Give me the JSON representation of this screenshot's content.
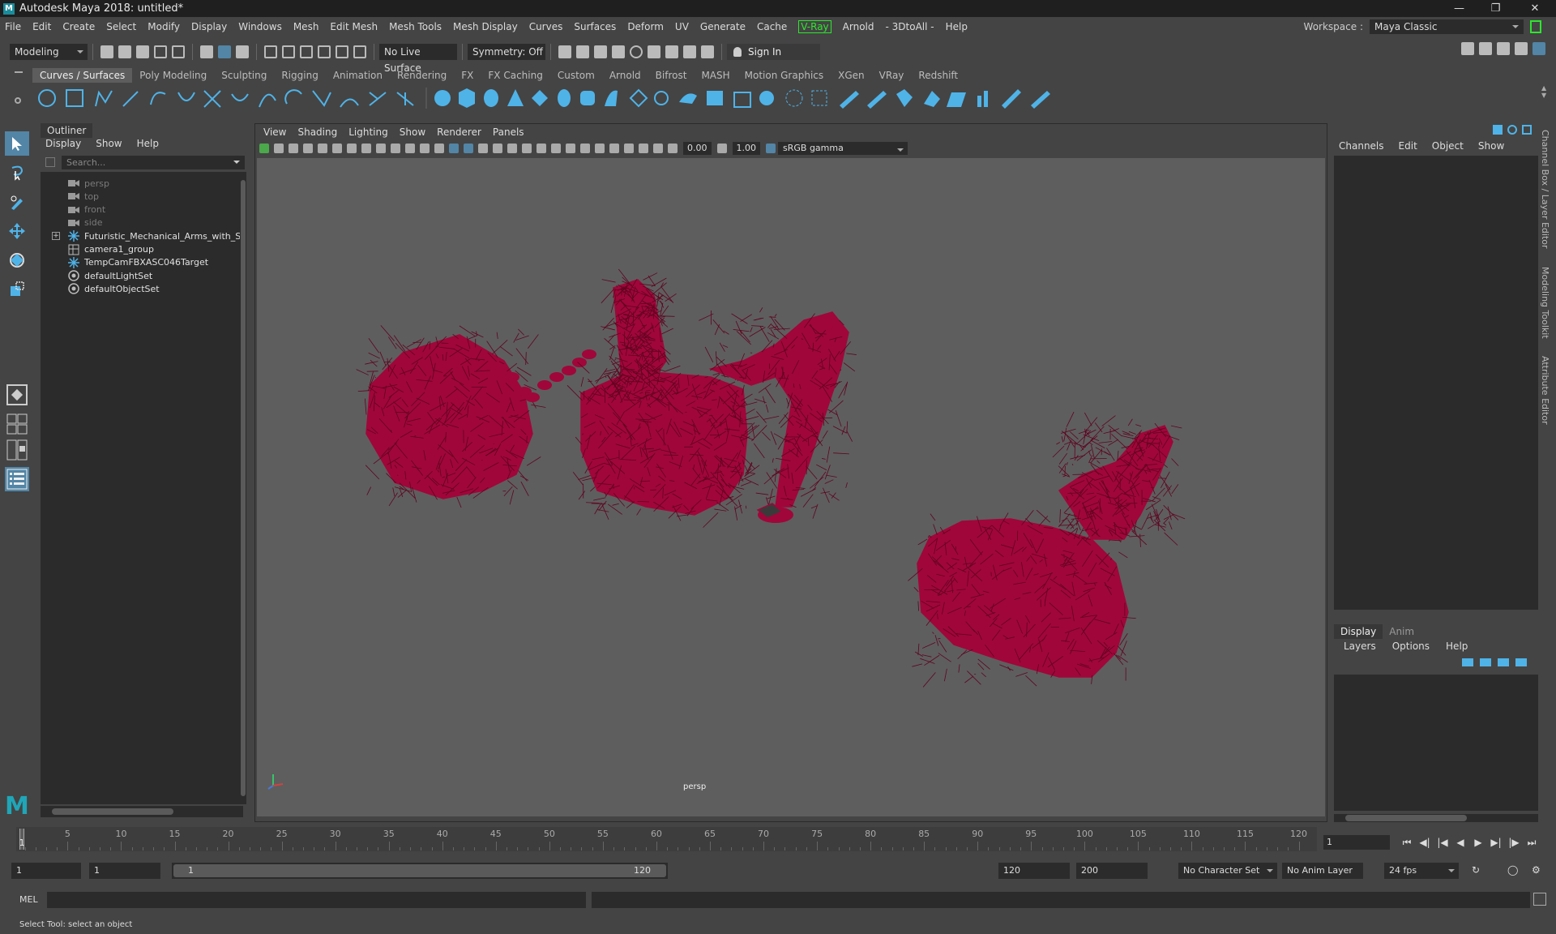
{
  "window": {
    "title": "Autodesk Maya 2018: untitled*",
    "logo": "M"
  },
  "menubar": [
    "File",
    "Edit",
    "Create",
    "Select",
    "Modify",
    "Display",
    "Windows",
    "Mesh",
    "Edit Mesh",
    "Mesh Tools",
    "Mesh Display",
    "Curves",
    "Surfaces",
    "Deform",
    "UV",
    "Generate",
    "Cache",
    "V-Ray",
    "Arnold",
    "- 3DtoAll -",
    "Help"
  ],
  "workspace": {
    "label": "Workspace :",
    "value": "Maya Classic"
  },
  "statusline": {
    "mode": "Modeling",
    "live_surface": "No Live Surface",
    "symmetry": "Symmetry: Off",
    "sign_in": "Sign In"
  },
  "shelf_tabs": [
    "Curves / Surfaces",
    "Poly Modeling",
    "Sculpting",
    "Rigging",
    "Animation",
    "Rendering",
    "FX",
    "FX Caching",
    "Custom",
    "Arnold",
    "Bifrost",
    "MASH",
    "Motion Graphics",
    "XGen",
    "VRay",
    "Redshift"
  ],
  "outliner": {
    "tab": "Outliner",
    "menu": [
      "Display",
      "Show",
      "Help"
    ],
    "search_placeholder": "Search...",
    "items": [
      {
        "label": "persp",
        "dim": true,
        "icon": "camera-icon"
      },
      {
        "label": "top",
        "dim": true,
        "icon": "camera-icon"
      },
      {
        "label": "front",
        "dim": true,
        "icon": "camera-icon"
      },
      {
        "label": "side",
        "dim": true,
        "icon": "camera-icon"
      },
      {
        "label": "Futuristic_Mechanical_Arms_with_Sup",
        "dim": false,
        "icon": "locator-icon"
      },
      {
        "label": "camera1_group",
        "dim": false,
        "icon": "group-icon"
      },
      {
        "label": "TempCamFBXASC046Target",
        "dim": false,
        "icon": "locator-icon"
      },
      {
        "label": "defaultLightSet",
        "dim": false,
        "icon": "set-icon"
      },
      {
        "label": "defaultObjectSet",
        "dim": false,
        "icon": "set-icon"
      }
    ]
  },
  "viewport": {
    "menu": [
      "View",
      "Shading",
      "Lighting",
      "Show",
      "Renderer",
      "Panels"
    ],
    "exposure": "0.00",
    "gamma": "1.00",
    "color_space": "sRGB gamma",
    "camera_label": "persp",
    "wire_color": "#a0063a",
    "bg_color": "#5e5e5e"
  },
  "channelbox": {
    "menu": [
      "Channels",
      "Edit",
      "Object",
      "Show"
    ],
    "side_tabs": [
      "Channel Box / Layer Editor",
      "Modeling Toolkit",
      "Attribute Editor"
    ]
  },
  "layers": {
    "tabs": [
      "Display",
      "Anim"
    ],
    "menu": [
      "Layers",
      "Options",
      "Help"
    ]
  },
  "timeline": {
    "ticks": [
      "5",
      "10",
      "15",
      "20",
      "25",
      "30",
      "35",
      "40",
      "45",
      "50",
      "55",
      "60",
      "65",
      "70",
      "75",
      "80",
      "85",
      "90",
      "95",
      "100",
      "105",
      "110",
      "115",
      "120"
    ],
    "current": "1",
    "current_field": "1"
  },
  "range": {
    "start": "1",
    "anim_start": "1",
    "range_start": "1",
    "range_end": "120",
    "anim_end": "120",
    "end": "200",
    "character_set": "No Character Set",
    "anim_layer": "No Anim Layer",
    "fps": "24 fps"
  },
  "cmdline": {
    "label": "MEL"
  },
  "helpline": "Select Tool: select an object"
}
